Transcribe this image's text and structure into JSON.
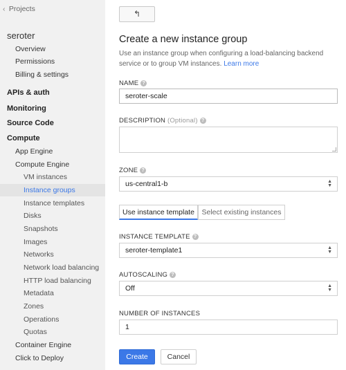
{
  "sidebar": {
    "back_label": "Projects",
    "project_name": "seroter",
    "project_items": [
      "Overview",
      "Permissions",
      "Billing & settings"
    ],
    "sections": {
      "apis": "APIs & auth",
      "monitoring": "Monitoring",
      "source": "Source Code",
      "compute": "Compute"
    },
    "compute_items": {
      "app_engine": "App Engine",
      "compute_engine": "Compute Engine",
      "container_engine": "Container Engine",
      "click_to_deploy": "Click to Deploy"
    },
    "compute_engine_items": [
      "VM instances",
      "Instance groups",
      "Instance templates",
      "Disks",
      "Snapshots",
      "Images",
      "Networks",
      "Network load balancing",
      "HTTP load balancing",
      "Metadata",
      "Zones",
      "Operations",
      "Quotas"
    ],
    "active_item": "Instance groups",
    "active_color": "#3b78e7"
  },
  "main": {
    "back_button_icon": "back-arrow-icon",
    "back_glyph": "↰",
    "title": "Create a new instance group",
    "description": "Use an instance group when configuring a load-balancing backend service or to group VM instances.",
    "learn_more": "Learn more",
    "name_label": "NAME",
    "name_value": "seroter-scale",
    "description_label": "DESCRIPTION",
    "description_optional": "(Optional)",
    "description_value": "",
    "zone_label": "ZONE",
    "zone_value": "us-central1-b",
    "tabs": [
      "Use instance template",
      "Select existing instances"
    ],
    "active_tab": "Use instance template",
    "template_label": "INSTANCE TEMPLATE",
    "template_value": "seroter-template1",
    "autoscaling_label": "AUTOSCALING",
    "autoscaling_value": "Off",
    "instances_label": "NUMBER OF INSTANCES",
    "instances_value": "1",
    "create_label": "Create",
    "cancel_label": "Cancel",
    "primary_color": "#3b78e7"
  }
}
